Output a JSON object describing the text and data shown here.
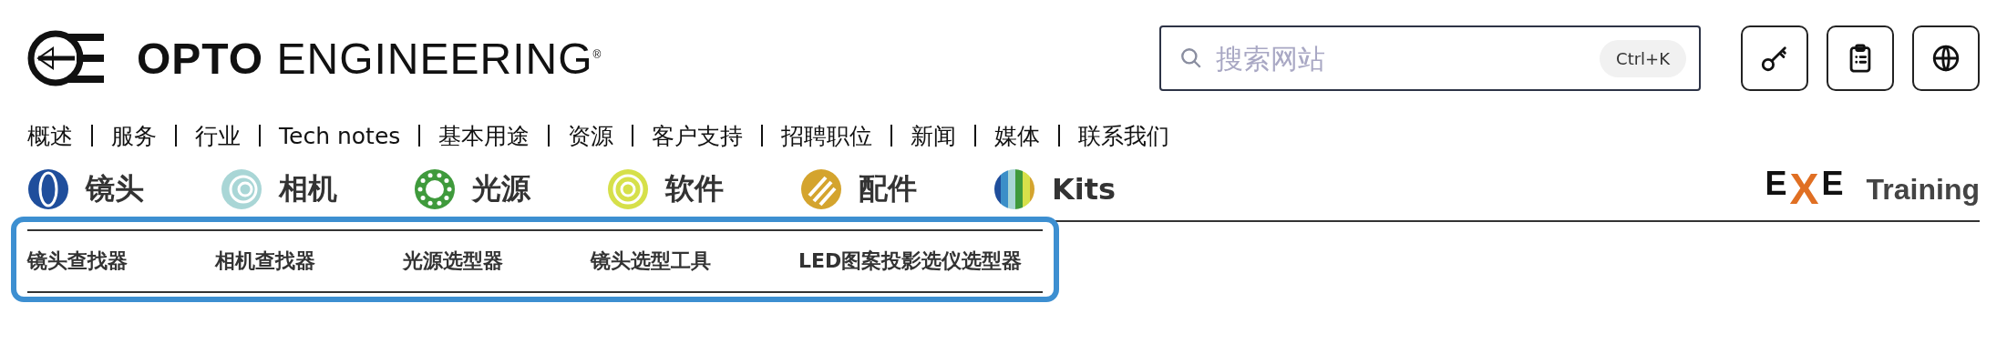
{
  "header": {
    "brand": {
      "strong": "OPTO",
      "light": "ENGINEERING",
      "mark": "®"
    },
    "search": {
      "placeholder": "搜索网站",
      "shortcut": "Ctrl+K"
    },
    "actions": [
      {
        "kind": "key"
      },
      {
        "kind": "clipboard"
      },
      {
        "kind": "globe"
      }
    ]
  },
  "nav": [
    "概述",
    "服务",
    "行业",
    "Tech notes",
    "基本用途",
    "资源",
    "客户支持",
    "招聘职位",
    "新闻",
    "媒体",
    "联系我们"
  ],
  "categories": [
    {
      "label": "镜头",
      "kind": "lens",
      "color": "#1f4e9c"
    },
    {
      "label": "相机",
      "kind": "camera",
      "color": "#a9d6d6"
    },
    {
      "label": "光源",
      "kind": "light",
      "color": "#3f9a3c"
    },
    {
      "label": "软件",
      "kind": "software",
      "color": "#d6e04a"
    },
    {
      "label": "配件",
      "kind": "accessory",
      "color": "#d4a42e"
    },
    {
      "label": "Kits",
      "kind": "kits",
      "color": "#3b8fc8"
    }
  ],
  "training": {
    "logo": [
      "E",
      "X",
      "E"
    ],
    "label": "Training"
  },
  "tools": {
    "highlighted": true,
    "items": [
      "镜头查找器",
      "相机查找器",
      "光源选型器",
      "镜头选型工具",
      "LED图案投影选仪选型器"
    ]
  }
}
